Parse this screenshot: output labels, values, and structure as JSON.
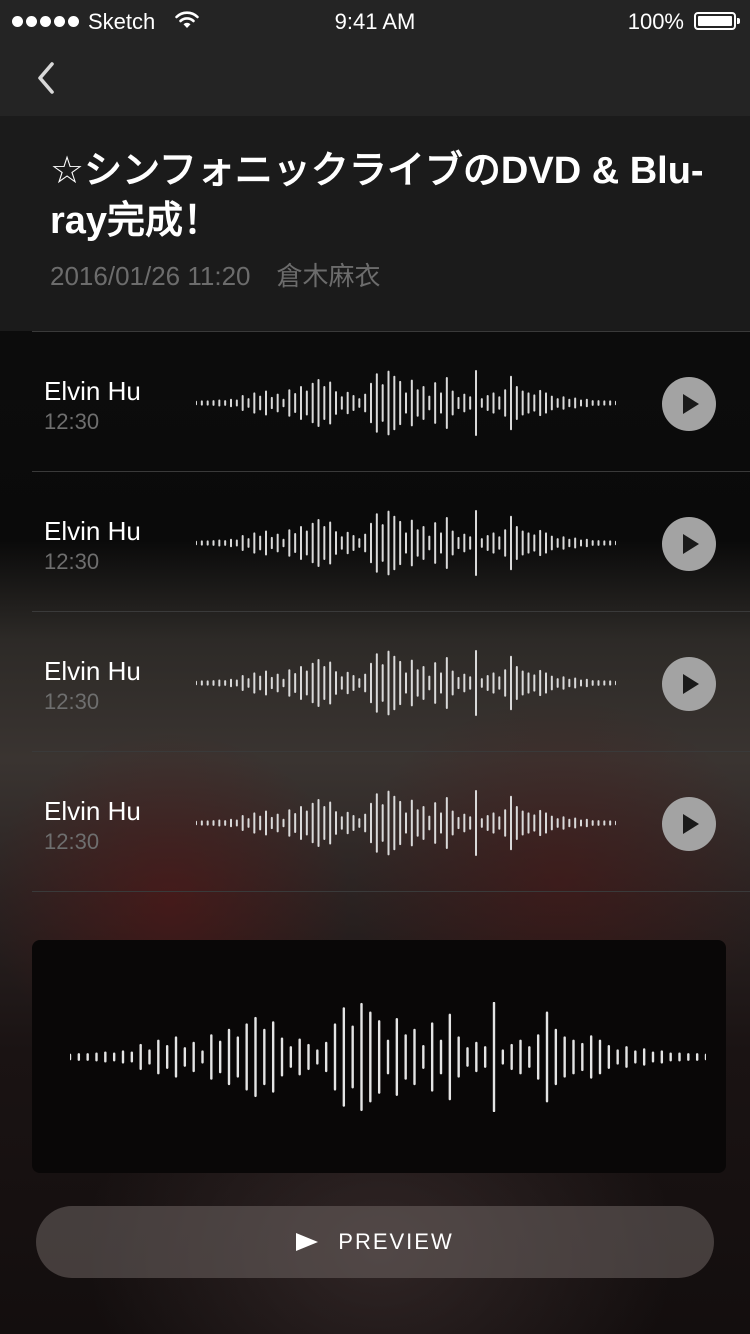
{
  "status_bar": {
    "carrier": "Sketch",
    "time": "9:41 AM",
    "battery": "100%",
    "signal_bars": 5,
    "icons": [
      "signal-icon",
      "wifi-icon",
      "battery-icon"
    ]
  },
  "nav": {
    "back_icon": "chevron-left-icon"
  },
  "post": {
    "title": "☆シンフォニックライブのDVD & Blu-ray完成！",
    "date": "2016/01/26 11:20",
    "author": "倉木麻衣"
  },
  "messages": [
    {
      "sender": "Elvin Hu",
      "duration": "12:30"
    },
    {
      "sender": "Elvin Hu",
      "duration": "12:30"
    },
    {
      "sender": "Elvin Hu",
      "duration": "12:30"
    },
    {
      "sender": "Elvin Hu",
      "duration": "12:30"
    }
  ],
  "preview_button": {
    "label": "PREVIEW",
    "icon": "play-icon"
  },
  "colors": {
    "header_bg": "#1b1b1b",
    "statusbar_bg": "#242424",
    "meta_text": "#6c6c6c",
    "play_button": "#a3a3a3"
  }
}
